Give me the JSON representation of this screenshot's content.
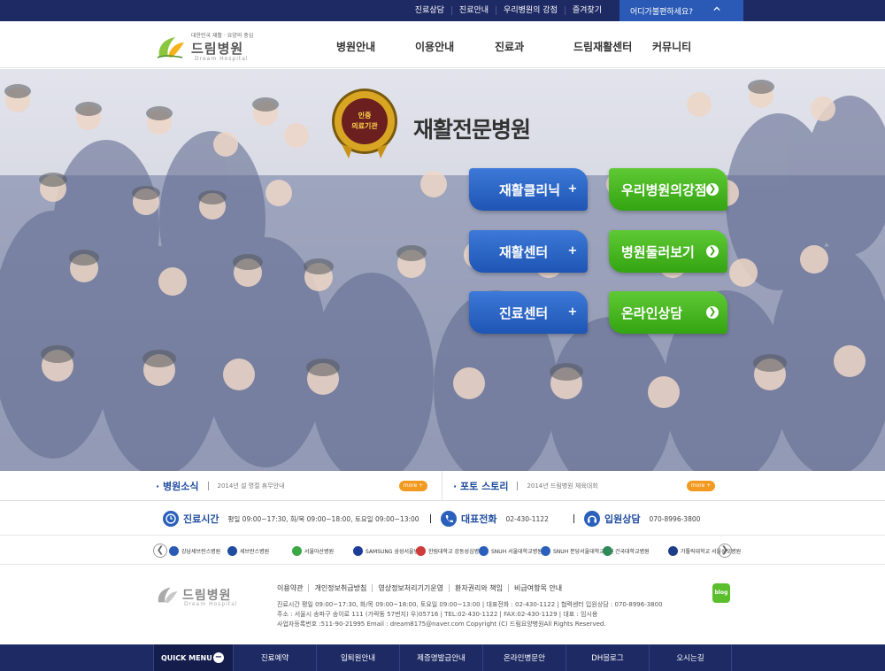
{
  "topbar": {
    "links": [
      "진료상담",
      "진료안내",
      "우리병원의 강점",
      "즐겨찾기"
    ],
    "help_label": "어디가불편하세요?"
  },
  "header": {
    "tagline": "대한민국 재활 · 요양의 중심",
    "logo_name": "드림병원",
    "logo_eng": "Dream Hospital",
    "nav": [
      "병원안내",
      "이용안내",
      "진료과",
      "드림재활센터",
      "커뮤니티"
    ]
  },
  "hero": {
    "badge_text": "인증\n의료기관",
    "title": "재활전문병원",
    "buttons": [
      {
        "label": "재활클리닉",
        "style": "blue",
        "icon": "plus-icon"
      },
      {
        "label": "우리병원의강점",
        "style": "green",
        "icon": "chevron-right-icon"
      },
      {
        "label": "재활센터",
        "style": "blue",
        "icon": "plus-icon"
      },
      {
        "label": "병원둘러보기",
        "style": "green",
        "icon": "chevron-right-icon"
      },
      {
        "label": "진료센터",
        "style": "blue",
        "icon": "plus-icon"
      },
      {
        "label": "온라인상담",
        "style": "green",
        "icon": "chevron-right-icon"
      }
    ]
  },
  "news": {
    "left": {
      "title": "· 병원소식",
      "text": "2014년 설 명절 휴무안내",
      "more": "more +"
    },
    "right": {
      "title": "· 포토 스토리",
      "text": "2014년 드림병원 체육대회",
      "more": "more +"
    }
  },
  "info": {
    "hours": {
      "label": "진료시간",
      "value": "평일 09:00~17:30, 화/목 09:00~18:00, 토요일 09:00~13:00"
    },
    "phone": {
      "label": "대표전화",
      "value": "02-430-1122"
    },
    "admission": {
      "label": "입원상담",
      "value": "070-8996-3800"
    }
  },
  "partners": [
    "강남세브란스병원",
    "세브란스병원",
    "서울아산병원",
    "SAMSUNG 삼성서울병원",
    "한림대학교 강동성심병원",
    "SNUH 서울대학교병원",
    "SNUH 분당서울대학교병원",
    "건국대학교병원",
    "가톨릭대학교 서울성모병원"
  ],
  "footer": {
    "logo_name": "드림병원",
    "logo_eng": "Dream Hospital",
    "links": [
      "이용약관",
      "개인정보취급방침",
      "영상정보처리기기운영",
      "환자권리와 책임",
      "비급여항목 안내"
    ],
    "address_lines": [
      "진료시간 평일 09:00~17:30, 화/목 09:00~18:00, 토요일 09:00~13:00  |  대표전화 : 02-430-1122  |  협력센터 입원상담 : 070-8996-3800",
      "주소 : 서울시 송파구 송이로 111 (가락동 57번지) 우)05716  |  TEL:02-430-1122  |  FAX:02-430-1129  |  대표 : 임시용",
      "사업자등록번호 :511-90-21995 Email : dream8175@naver.com Copyright (C) 드림요양병원All Rights Reserved."
    ],
    "blog_label": "blog"
  },
  "quick": {
    "title": "QUICK MENU",
    "items": [
      "진료예약",
      "입퇴원안내",
      "제증명발급안내",
      "온라인병문안",
      "DH블로그",
      "오시는길"
    ]
  },
  "colors": {
    "navy": "#1e2a64",
    "accent_blue": "#2a5ab5",
    "green": "#3aa814",
    "orange": "#f29a1f"
  }
}
